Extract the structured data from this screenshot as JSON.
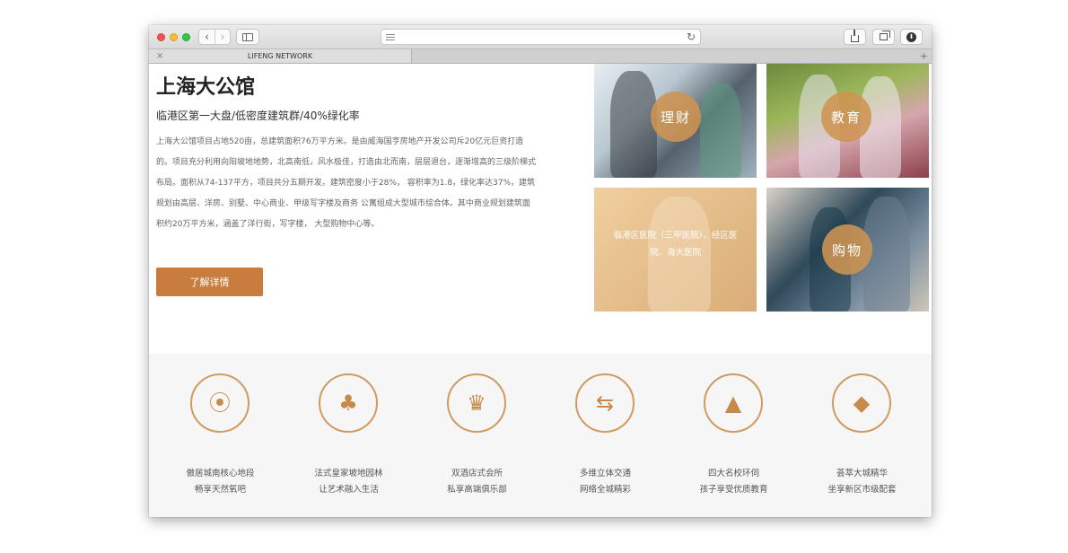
{
  "browser": {
    "tab_title": "LIFENG NETWORK",
    "close_tab": "×",
    "new_tab": "+",
    "back": "‹",
    "forward": "›",
    "reload": "↻"
  },
  "hero": {
    "title": "上海大公馆",
    "subtitle": "临港区第一大盘/低密度建筑群/40%绿化率",
    "description": "上海大公馆项目占地520亩，总建筑面积76万平方米。是由威海国亨房地产开发公司斥20亿元巨资打造的。项目充分利用向阳坡地地势，北高南低，风水极佳，打造由北而南，层层退台，逐渐增高的三级阶梯式布局。面积从74-137平方，项目共分五期开发。建筑密度小于28%， 容积率为1.8，绿化率达37%，建筑规划由高层、洋房、别墅、中心商业、甲级写字楼及商务 公寓组成大型城市综合体。其中商业规划建筑面积约20万平方米，涵盖了洋行街，写字楼， 大型购物中心等。",
    "cta_label": "了解详情"
  },
  "tiles": [
    {
      "label": "理财",
      "icon": "finance-photo"
    },
    {
      "label": "教育",
      "icon": "education-photo"
    },
    {
      "label": "临港区医院（三甲医院）、经区医院、海大医院",
      "icon": "hospital-photo"
    },
    {
      "label": "购物",
      "icon": "shopping-photo"
    }
  ],
  "features": [
    {
      "line1": "傲居城南核心地段",
      "line2": "畅享天然氧吧",
      "icon": "location-pin-icon"
    },
    {
      "line1": "法式皇家坡地园林",
      "line2": "让艺术融入生活",
      "icon": "garden-icon"
    },
    {
      "line1": "双酒店式会所",
      "line2": "私享高端俱乐部",
      "icon": "crown-icon"
    },
    {
      "line1": "多维立体交通",
      "line2": "网络全城精彩",
      "icon": "signpost-icon"
    },
    {
      "line1": "四大名校环伺",
      "line2": "孩子享受优质教育",
      "icon": "graduation-cap-icon"
    },
    {
      "line1": "荟萃大城精华",
      "line2": "坐享新区市级配套",
      "icon": "diamond-icon"
    }
  ],
  "colors": {
    "accent": "#c87d3e",
    "circle_border": "#d19a60",
    "tile_overlay": "#ce9452"
  }
}
